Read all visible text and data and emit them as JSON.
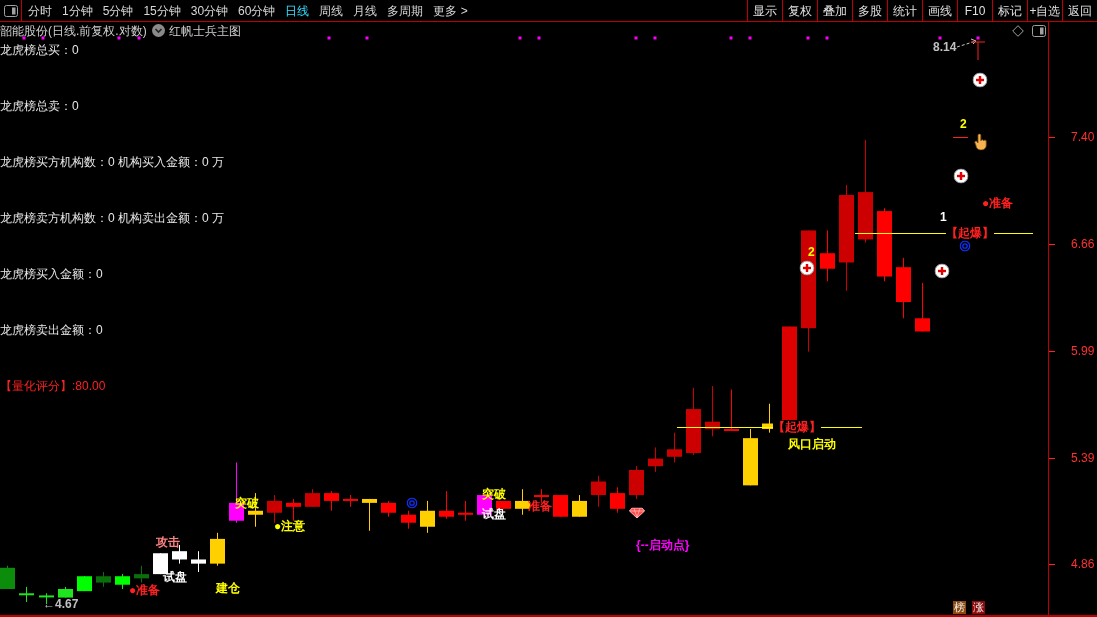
{
  "toolbar": {
    "period_tabs": [
      {
        "label": "分时",
        "selected": false
      },
      {
        "label": "1分钟",
        "selected": false
      },
      {
        "label": "5分钟",
        "selected": false
      },
      {
        "label": "15分钟",
        "selected": false
      },
      {
        "label": "30分钟",
        "selected": false
      },
      {
        "label": "60分钟",
        "selected": false
      },
      {
        "label": "日线",
        "selected": true
      },
      {
        "label": "周线",
        "selected": false
      },
      {
        "label": "月线",
        "selected": false
      },
      {
        "label": "多周期",
        "selected": false
      },
      {
        "label": "更多 >",
        "selected": false
      }
    ],
    "buttons": [
      "显示",
      "复权",
      "叠加",
      "多股",
      "统计",
      "画线",
      "F10",
      "标记",
      "+自选",
      "返回"
    ]
  },
  "chart": {
    "title": "韶能股份(日线.前复权.对数)",
    "indicator": "红帆士兵主图",
    "info_lines": [
      {
        "text": "龙虎榜总买：0",
        "color": "#e6e6e6"
      },
      {
        "text": "龙虎榜总卖：0",
        "color": "#e6e6e6"
      },
      {
        "text": "龙虎榜买方机构数：0 机构买入金额：0 万",
        "color": "#e6e6e6"
      },
      {
        "text": "龙虎榜卖方机构数：0 机构卖出金额：0 万",
        "color": "#e6e6e6"
      },
      {
        "text": "龙虎榜买入金额：0",
        "color": "#e6e6e6"
      },
      {
        "text": "龙虎榜卖出金额：0",
        "color": "#e6e6e6"
      },
      {
        "text": "【量化评分】:80.00",
        "color": "#ff2020"
      }
    ],
    "signals": [
      {
        "text": "8.14",
        "color": "#c0c0c0"
      },
      {
        "text": "2",
        "color": "#ffff00"
      },
      {
        "text": "●准备",
        "color": "#ff2020"
      },
      {
        "text": "1",
        "color": "#ffffff"
      },
      {
        "text": "【起爆】",
        "color": "#ff2020"
      },
      {
        "text": "2",
        "color": "#ffff00"
      },
      {
        "text": "【起爆】",
        "color": "#ff2020"
      },
      {
        "text": "风口启动",
        "color": "#ffff00"
      },
      {
        "text": "突破",
        "color": "#ffff00"
      },
      {
        "text": "突破",
        "color": "#ffff00"
      },
      {
        "text": "准备",
        "color": "#ff2020"
      },
      {
        "text": "试盘",
        "color": "#ffffff"
      },
      {
        "text": "●注意",
        "color": "#ffff00"
      },
      {
        "text": "{--启动点}",
        "color": "#ff00ff"
      },
      {
        "text": "攻击",
        "color": "#ff8080"
      },
      {
        "text": "试盘",
        "color": "#ffffff"
      },
      {
        "text": "●准备",
        "color": "#ff2020"
      },
      {
        "text": "建仓",
        "color": "#ffff00"
      },
      {
        "text": "←4.67",
        "color": "#c0c0c0"
      }
    ],
    "price_axis": [
      "7.40",
      "6.66",
      "5.99",
      "5.39",
      "4.86"
    ],
    "badges": [
      {
        "text": "榜",
        "color": "#8b4a10"
      },
      {
        "text": "涨",
        "color": "#8b0a0a"
      }
    ]
  }
}
